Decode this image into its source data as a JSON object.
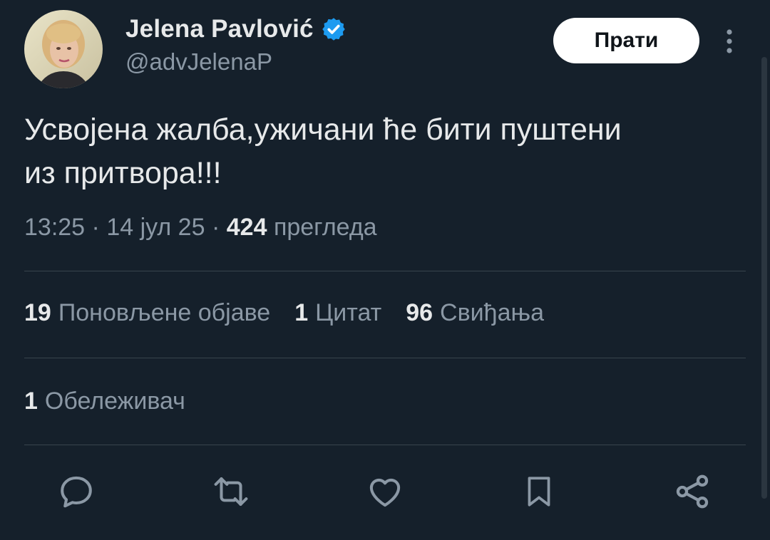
{
  "header": {
    "display_name": "Jelena Pavlović",
    "handle": "@advJelenaP",
    "follow_label": "Прати"
  },
  "tweet": {
    "text_line1": "Усвојена жалба,ужичани ће бити пуштени",
    "text_line2": "из притвора!!!",
    "time": "13:25",
    "date": "14 јул 25",
    "views_count": "424",
    "views_label": "прегледа"
  },
  "stats": {
    "reposts_count": "19",
    "reposts_label": "Поновљене објаве",
    "quotes_count": "1",
    "quotes_label": "Цитат",
    "likes_count": "96",
    "likes_label": "Свиђања",
    "bookmarks_count": "1",
    "bookmarks_label": "Обележивач"
  },
  "actions": {
    "icons": [
      "reply-icon",
      "repost-icon",
      "like-icon",
      "bookmark-icon",
      "share-icon"
    ]
  },
  "colors": {
    "background": "#15202b",
    "primary_text": "#e7e9ea",
    "secondary_text": "#8b98a5",
    "verified_blue": "#1d9bf0",
    "divider": "#38444d"
  }
}
